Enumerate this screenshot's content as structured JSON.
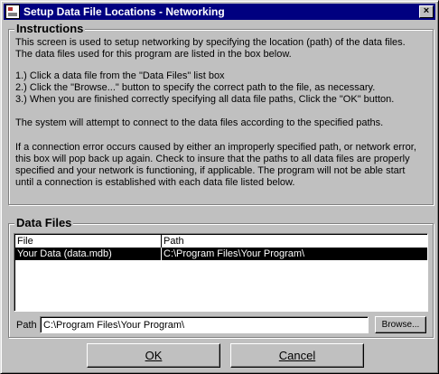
{
  "window": {
    "title": "Setup Data File Locations - Networking",
    "close_glyph": "×"
  },
  "instructions": {
    "title": "Instructions",
    "paragraphs": [
      "This screen is used to setup networking by specifying the location (path) of the data files.",
      "The data files used for this program are listed in the box below.",
      "1.)  Click a data file from the \"Data Files\" list box",
      "2.)  Click the \"Browse...\" button to specify the correct path to the file, as necessary.",
      "3.)  When you are finished correctly specifying all data file paths, Click the \"OK\" button.",
      "The system will attempt to connect to the data files according to the specified paths.",
      "If a connection error occurs caused by either an improperly specified path, or network error,",
      "this box will pop back up again.  Check to insure that the paths to all data files are properly",
      "specified and your network is functioning, if applicable.  The program will not be able start",
      "until a connection is established with each data file listed below."
    ]
  },
  "data_files": {
    "title": "Data Files",
    "columns": [
      "File",
      "Path"
    ],
    "rows": [
      {
        "file": "Your Data (data.mdb)",
        "path": "C:\\Program Files\\Your Program\\"
      }
    ],
    "path_label": "Path",
    "path_value": "C:\\Program Files\\Your Program\\",
    "browse_label": "Browse..."
  },
  "buttons": {
    "ok_label": "OK",
    "cancel_label": "Cancel"
  },
  "colors": {
    "titlebar": "#000080",
    "face": "#c0c0c0",
    "selection": "#000000"
  }
}
